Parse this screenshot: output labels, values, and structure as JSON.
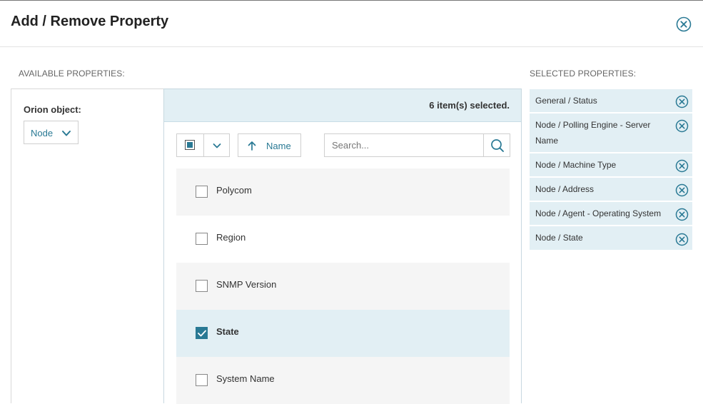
{
  "dialog": {
    "title": "Add / Remove Property"
  },
  "available": {
    "section_label": "AVAILABLE PROPERTIES:",
    "orion_object_label": "Orion object:",
    "orion_object_value": "Node"
  },
  "list": {
    "selected_count": "6 item(s) selected.",
    "sort_label": "Name",
    "search_placeholder": "Search...",
    "items": [
      {
        "label": "Polycom",
        "checked": false
      },
      {
        "label": "Region",
        "checked": false
      },
      {
        "label": "SNMP Version",
        "checked": false
      },
      {
        "label": "State",
        "checked": true
      },
      {
        "label": "System Name",
        "checked": false
      }
    ]
  },
  "selected": {
    "section_label": "SELECTED PROPERTIES:",
    "items": [
      "General / Status",
      "Node / Polling Engine - Server Name",
      "Node / Machine Type",
      "Node / Address",
      "Node / Agent - Operating System",
      "Node / State"
    ]
  },
  "colors": {
    "accent": "#297994",
    "selected_bg": "#e2eff4",
    "alt_row_bg": "#f5f5f5"
  }
}
